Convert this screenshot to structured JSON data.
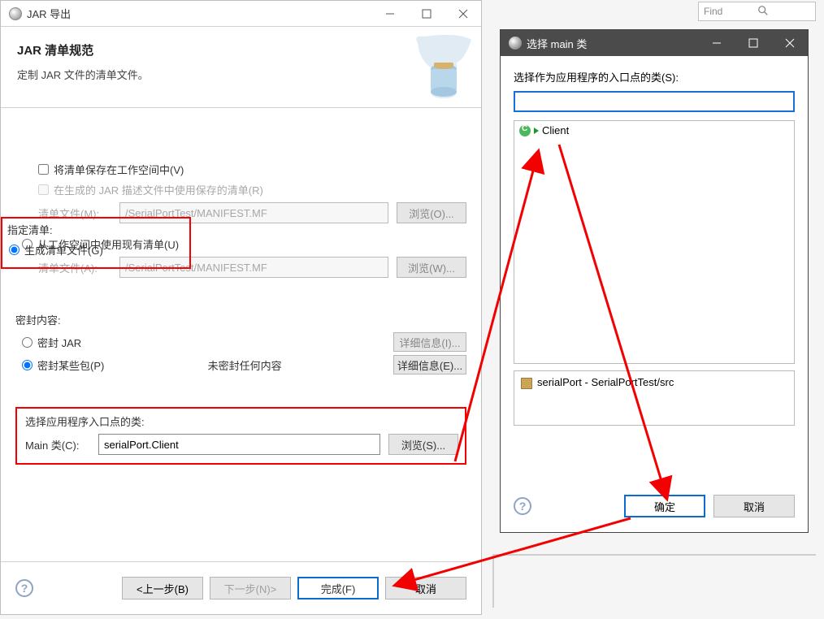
{
  "find_bar": {
    "placeholder": "Find"
  },
  "main": {
    "titlebar": "JAR 导出",
    "header_title": "JAR 清单规范",
    "header_desc": "定制 JAR 文件的清单文件。",
    "manifest": {
      "label_specify": "指定清单:",
      "radio_generate": "生成清单文件(G)",
      "check_save_ws": "将清单保存在工作空间中(V)",
      "check_reuse_saved": "在生成的 JAR 描述文件中使用保存的清单(R)",
      "field1_label": "清单文件(M):",
      "field1_value": "/SerialPortTest/MANIFEST.MF",
      "browse1": "浏览(O)...",
      "radio_use_existing": "从工作空间中使用现有清单(U)",
      "field2_label": "清单文件(A):",
      "field2_value": "/SerialPortTest/MANIFEST.MF",
      "browse2": "浏览(W)..."
    },
    "seal": {
      "label_title": "密封内容:",
      "option1": "密封 JAR",
      "option2": "密封某些包(P)",
      "unsealed_text": "未密封任何内容",
      "details1": "详细信息(I)...",
      "details2": "详细信息(E)..."
    },
    "entry": {
      "label": "选择应用程序入口点的类:",
      "main_label": "Main 类(C):",
      "main_value": "serialPort.Client",
      "browse": "浏览(S)..."
    },
    "footer": {
      "back": "<上一步(B)",
      "next": "下一步(N)>",
      "finish": "完成(F)",
      "cancel": "取消"
    }
  },
  "select": {
    "titlebar": "选择 main 类",
    "prompt": "选择作为应用程序的入口点的类(S):",
    "item": "Client",
    "package_info": "serialPort - SerialPortTest/src",
    "ok": "确定",
    "cancel": "取消"
  }
}
